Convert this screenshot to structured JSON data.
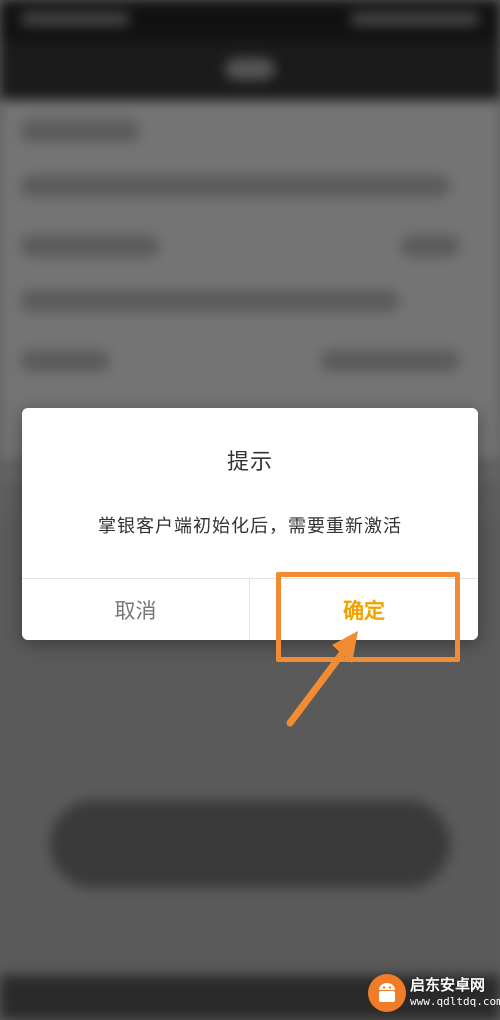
{
  "dialog": {
    "title": "提示",
    "message": "掌银客户端初始化后，需要重新激活",
    "cancel_label": "取消",
    "confirm_label": "确定"
  },
  "annotation": {
    "highlight_color": "#f28c33",
    "target": "confirm-button"
  },
  "watermark": {
    "name": "启东安卓网",
    "url": "www.qdltdq.com",
    "icon": "android-logo-icon"
  },
  "colors": {
    "confirm_text": "#f0a300",
    "cancel_text": "#777777",
    "accent_annotation": "#f28c33"
  }
}
